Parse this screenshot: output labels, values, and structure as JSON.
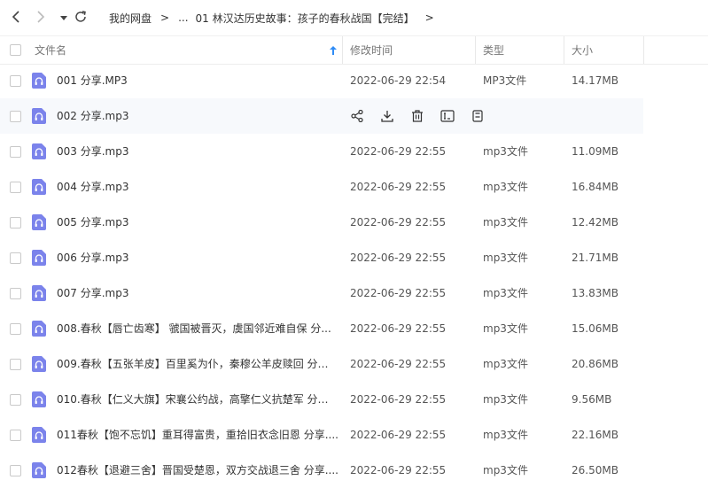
{
  "breadcrumb": {
    "root": "我的网盘",
    "sep": ">",
    "ellipsis": "...",
    "current": "01 林汉达历史故事：孩子的春秋战国【完结】"
  },
  "header": {
    "name": "文件名",
    "modified": "修改时间",
    "type": "类型",
    "size": "大小"
  },
  "icons": {
    "back": "chevron-left-icon",
    "forward": "chevron-right-icon",
    "history": "caret-down-icon",
    "refresh": "refresh-icon",
    "sort": "sort-arrow-up-icon",
    "file": "audio-file-icon",
    "share": "share-icon",
    "download": "download-icon",
    "delete": "trash-icon",
    "rename": "rename-icon",
    "more": "more-icon"
  },
  "colors": {
    "file_icon": "#7b83eb",
    "accent": "#2f8cf6",
    "hover_row": "#f7f9fc"
  },
  "files": [
    {
      "name": "001 分享.MP3",
      "date": "2022-06-29 22:54",
      "type": "MP3文件",
      "size": "14.17MB"
    },
    {
      "name": "002 分享.mp3",
      "date": "",
      "type": "",
      "size": "",
      "hover": true
    },
    {
      "name": "003 分享.mp3",
      "date": "2022-06-29 22:55",
      "type": "mp3文件",
      "size": "11.09MB"
    },
    {
      "name": "004 分享.mp3",
      "date": "2022-06-29 22:55",
      "type": "mp3文件",
      "size": "16.84MB"
    },
    {
      "name": "005 分享.mp3",
      "date": "2022-06-29 22:55",
      "type": "mp3文件",
      "size": "12.42MB"
    },
    {
      "name": "006 分享.mp3",
      "date": "2022-06-29 22:55",
      "type": "mp3文件",
      "size": "21.71MB"
    },
    {
      "name": "007 分享.mp3",
      "date": "2022-06-29 22:55",
      "type": "mp3文件",
      "size": "13.83MB"
    },
    {
      "name": "008.春秋【唇亡齿寒】 虢国被晋灭，虞国邻近难自保 分...",
      "date": "2022-06-29 22:55",
      "type": "mp3文件",
      "size": "15.06MB"
    },
    {
      "name": "009.春秋【五张羊皮】百里奚为仆，秦穆公羊皮赎回 分享....",
      "date": "2022-06-29 22:55",
      "type": "mp3文件",
      "size": "20.86MB"
    },
    {
      "name": "010.春秋【仁义大旗】宋襄公约战，高擎仁义抗楚军 分享....",
      "date": "2022-06-29 22:55",
      "type": "mp3文件",
      "size": "9.56MB"
    },
    {
      "name": "011春秋【饱不忘饥】重耳得富贵，重拾旧衣念旧恩 分享....",
      "date": "2022-06-29 22:55",
      "type": "mp3文件",
      "size": "22.16MB"
    },
    {
      "name": "012春秋【退避三舍】晋国受楚恩，双方交战退三舍 分享....",
      "date": "2022-06-29 22:55",
      "type": "mp3文件",
      "size": "26.50MB"
    }
  ]
}
